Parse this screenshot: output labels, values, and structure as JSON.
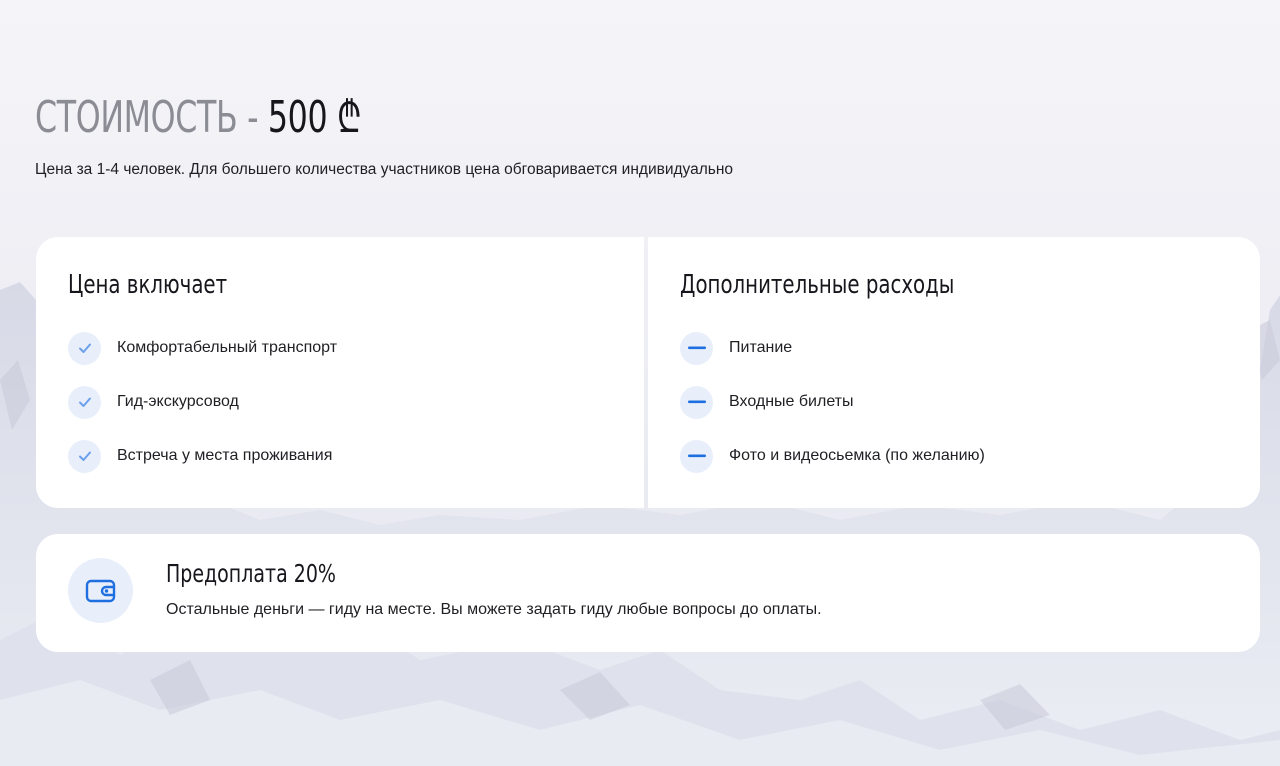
{
  "price": {
    "label": "СТОИМОСТЬ",
    "separator": "-",
    "amount": "500",
    "currency": "₾"
  },
  "subtitle": "Цена за 1-4 человек. Для большего количества участников цена обговаривается индивидуально",
  "included": {
    "heading": "Цена включает",
    "items": [
      {
        "label": "Комфортабельный транспорт",
        "icon": "check-icon"
      },
      {
        "label": "Гид-экскурсовод",
        "icon": "check-icon"
      },
      {
        "label": "Встреча у места проживания",
        "icon": "check-icon"
      }
    ]
  },
  "extra": {
    "heading": "Дополнительные расходы",
    "items": [
      {
        "label": "Питание",
        "icon": "minus-icon"
      },
      {
        "label": "Входные билеты",
        "icon": "minus-icon"
      },
      {
        "label": "Фото и видеосьемка (по желанию)",
        "icon": "minus-icon"
      }
    ]
  },
  "prepayment": {
    "icon": "wallet-icon",
    "title": "Предоплата 20%",
    "text": "Остальные деньги — гиду на месте. Вы можете задать гиду любые вопросы до оплаты."
  },
  "colors": {
    "accent": "#1f6fe0",
    "check": "#6aa0ec",
    "bullet_bg": "#e8effb",
    "muted_title": "#8c8c95"
  }
}
